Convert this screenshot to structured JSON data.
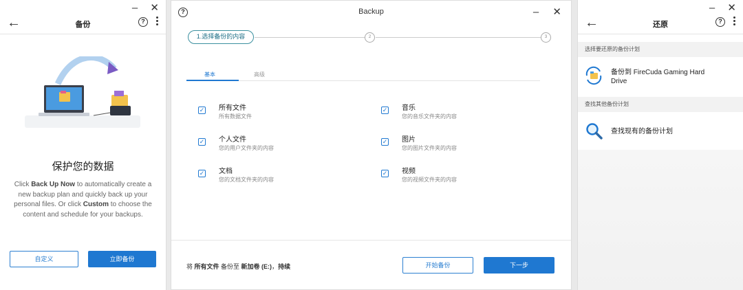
{
  "left": {
    "title": "备份",
    "heading": "保护您的数据",
    "desc_1": "Click ",
    "desc_b1": "Back Up Now",
    "desc_2": " to automatically create a new backup plan and quickly back up your personal files. Or click ",
    "desc_b2": "Custom",
    "desc_3": " to choose the content and schedule for your backups.",
    "custom_btn": "自定义",
    "backup_now_btn": "立即备份"
  },
  "mid": {
    "title": "Backup",
    "step1": "1.选择备份的内容",
    "step2": "2",
    "step3": "3",
    "tabs": [
      "基本",
      "高级"
    ],
    "options": [
      {
        "title": "所有文件",
        "sub": "所有数据文件"
      },
      {
        "title": "音乐",
        "sub": "您的音乐文件夹的内容"
      },
      {
        "title": "个人文件",
        "sub": "您的用户文件夹的内容"
      },
      {
        "title": "图片",
        "sub": "您的图片文件夹的内容"
      },
      {
        "title": "文档",
        "sub": "您的文档文件夹的内容"
      },
      {
        "title": "视频",
        "sub": "您的视频文件夹的内容"
      }
    ],
    "footer": {
      "p1": "将 ",
      "b1": "所有文件",
      "p2": " 备份至 ",
      "b2": "新加卷 (E:)",
      "p3": "，",
      "b3": "持续"
    },
    "start_btn": "开始备份",
    "next_btn": "下一步"
  },
  "right": {
    "title": "还原",
    "section1": "选择要还原的备份计划",
    "plan": "备份到 FireCuda Gaming Hard Drive",
    "section2": "查找其他备份计划",
    "find": "查找现有的备份计划"
  },
  "colors": {
    "accent": "#1f78d1",
    "step_teal": "#3a8f9f"
  }
}
